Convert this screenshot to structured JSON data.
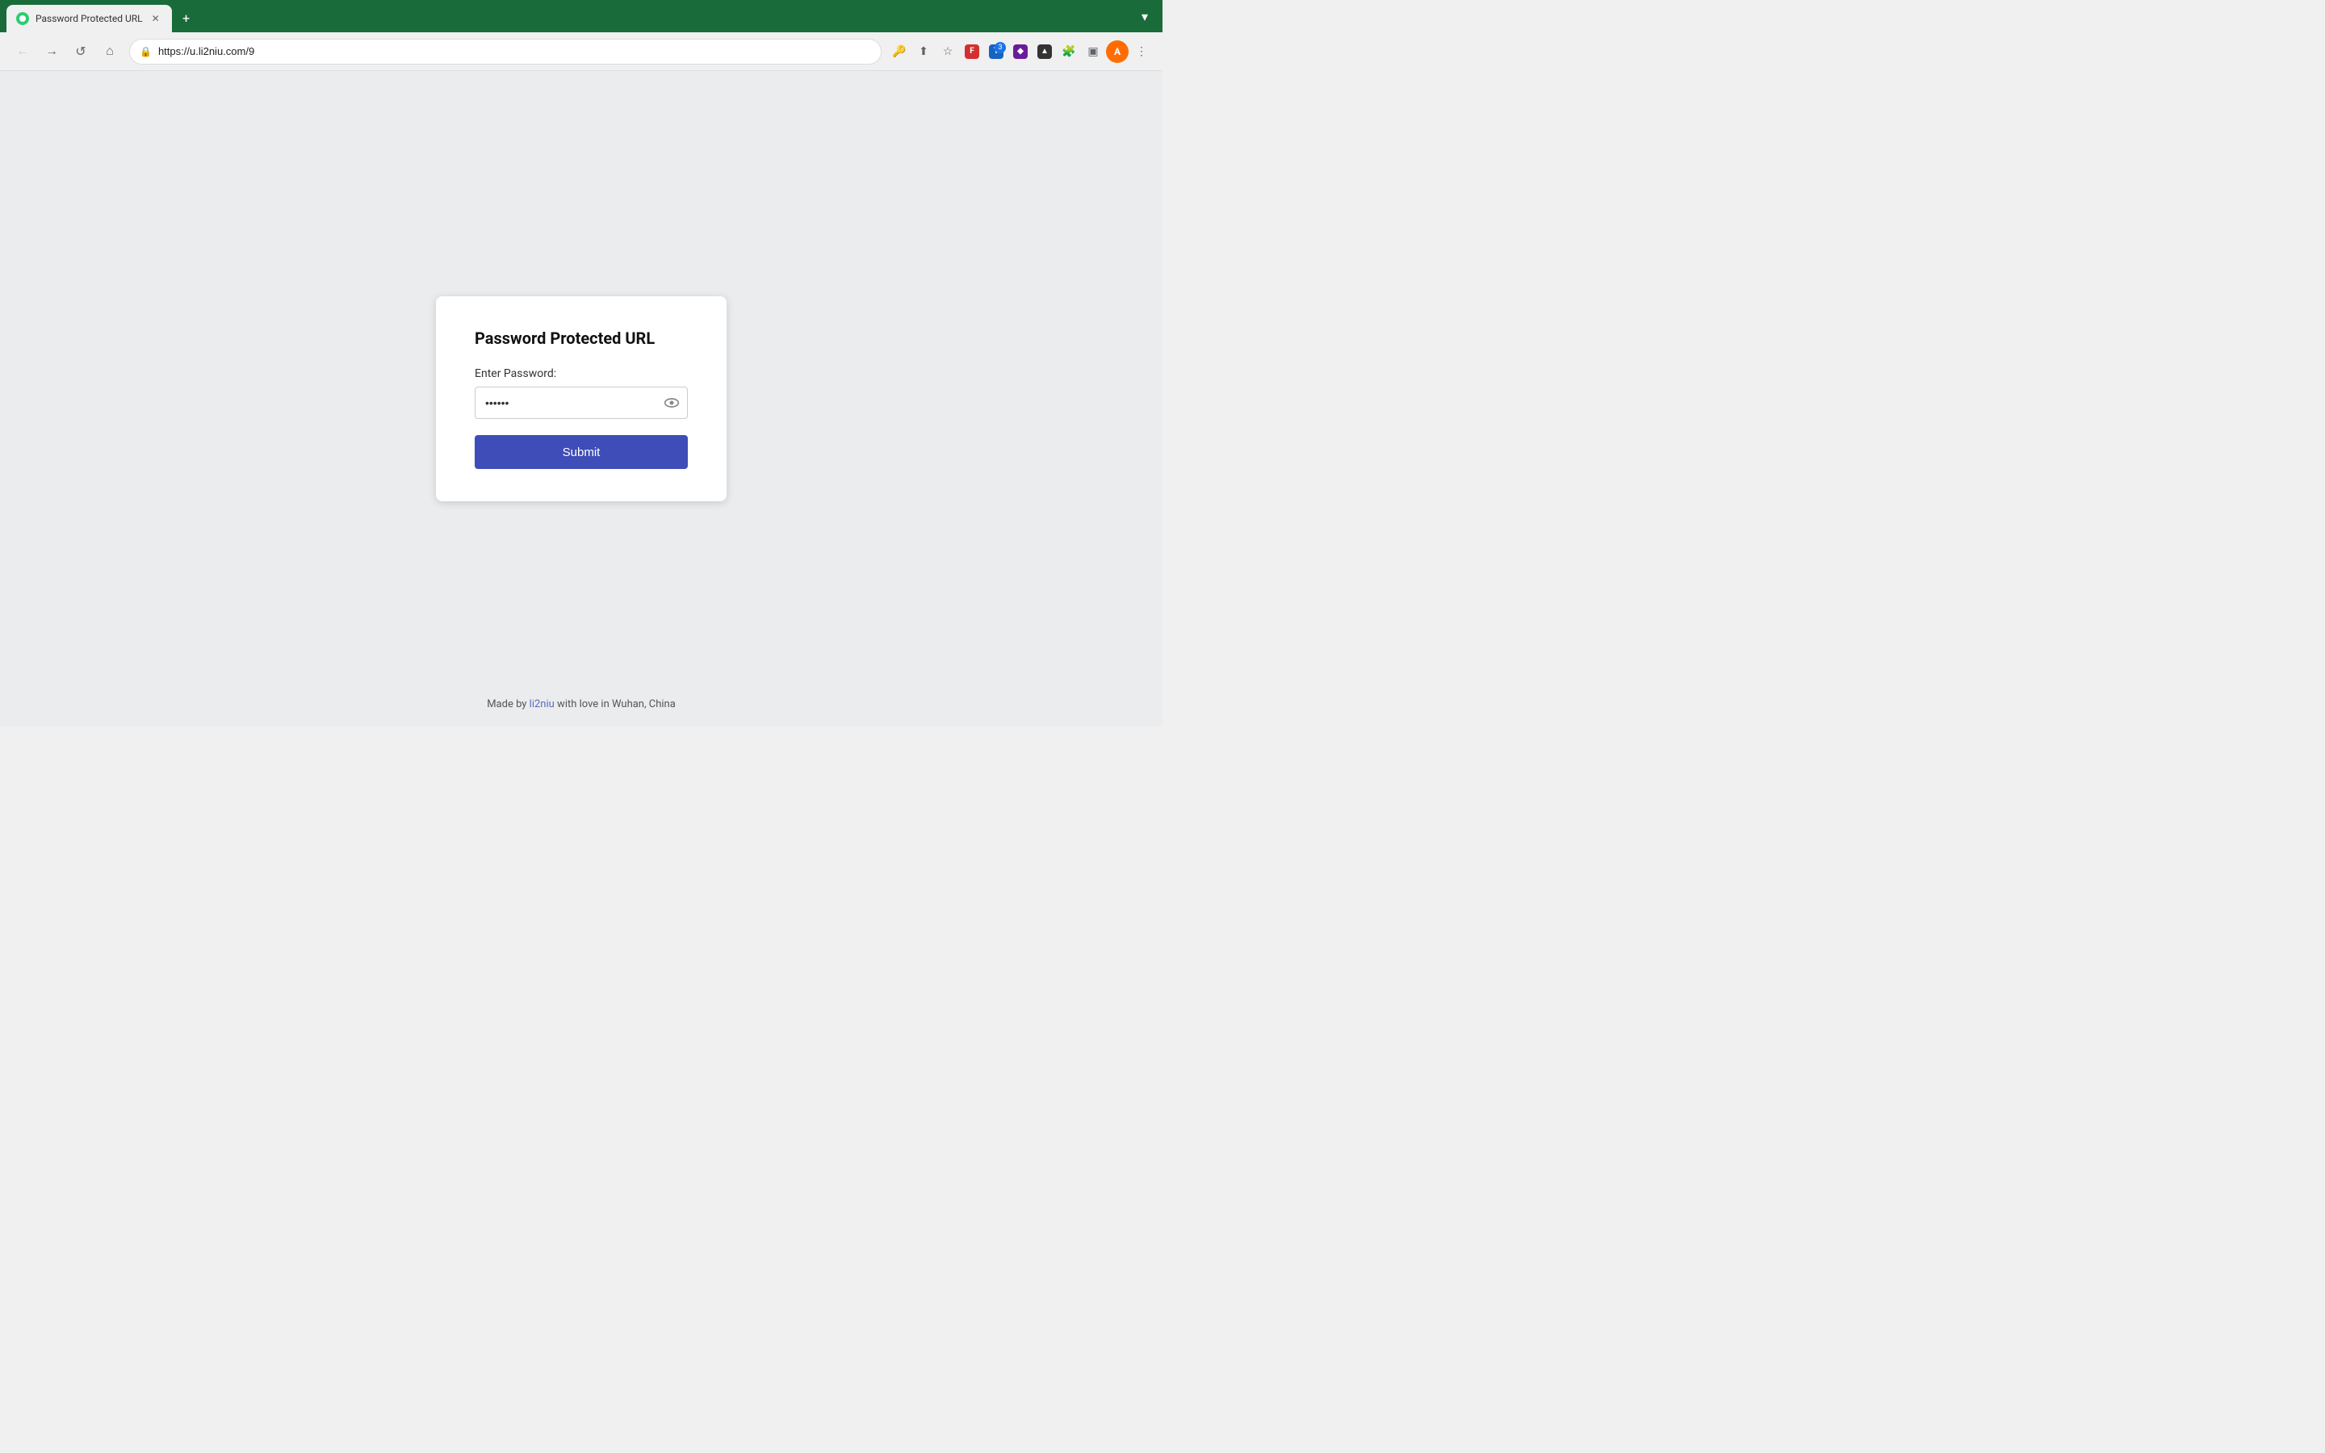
{
  "browser": {
    "tab": {
      "title": "Password Protected URL",
      "favicon_label": "site-favicon"
    },
    "new_tab_label": "+",
    "minimize_label": "▾",
    "toolbar": {
      "url": "https://u.li2niu.com/9",
      "back_label": "←",
      "forward_label": "→",
      "reload_label": "↺",
      "home_label": "⌂",
      "bookmark_label": "☆",
      "share_label": "⬆",
      "key_label": "🔑",
      "extensions_label": "🧩",
      "sidebar_label": "▣",
      "menu_label": "⋮",
      "badge_count": "3"
    }
  },
  "page": {
    "title": "Password Protected URL",
    "field_label": "Enter Password:",
    "password_value": "••••••",
    "submit_label": "Submit",
    "footer_text_before": "Made by ",
    "footer_link_text": "li2niu",
    "footer_text_after": " with love in Wuhan, China"
  }
}
